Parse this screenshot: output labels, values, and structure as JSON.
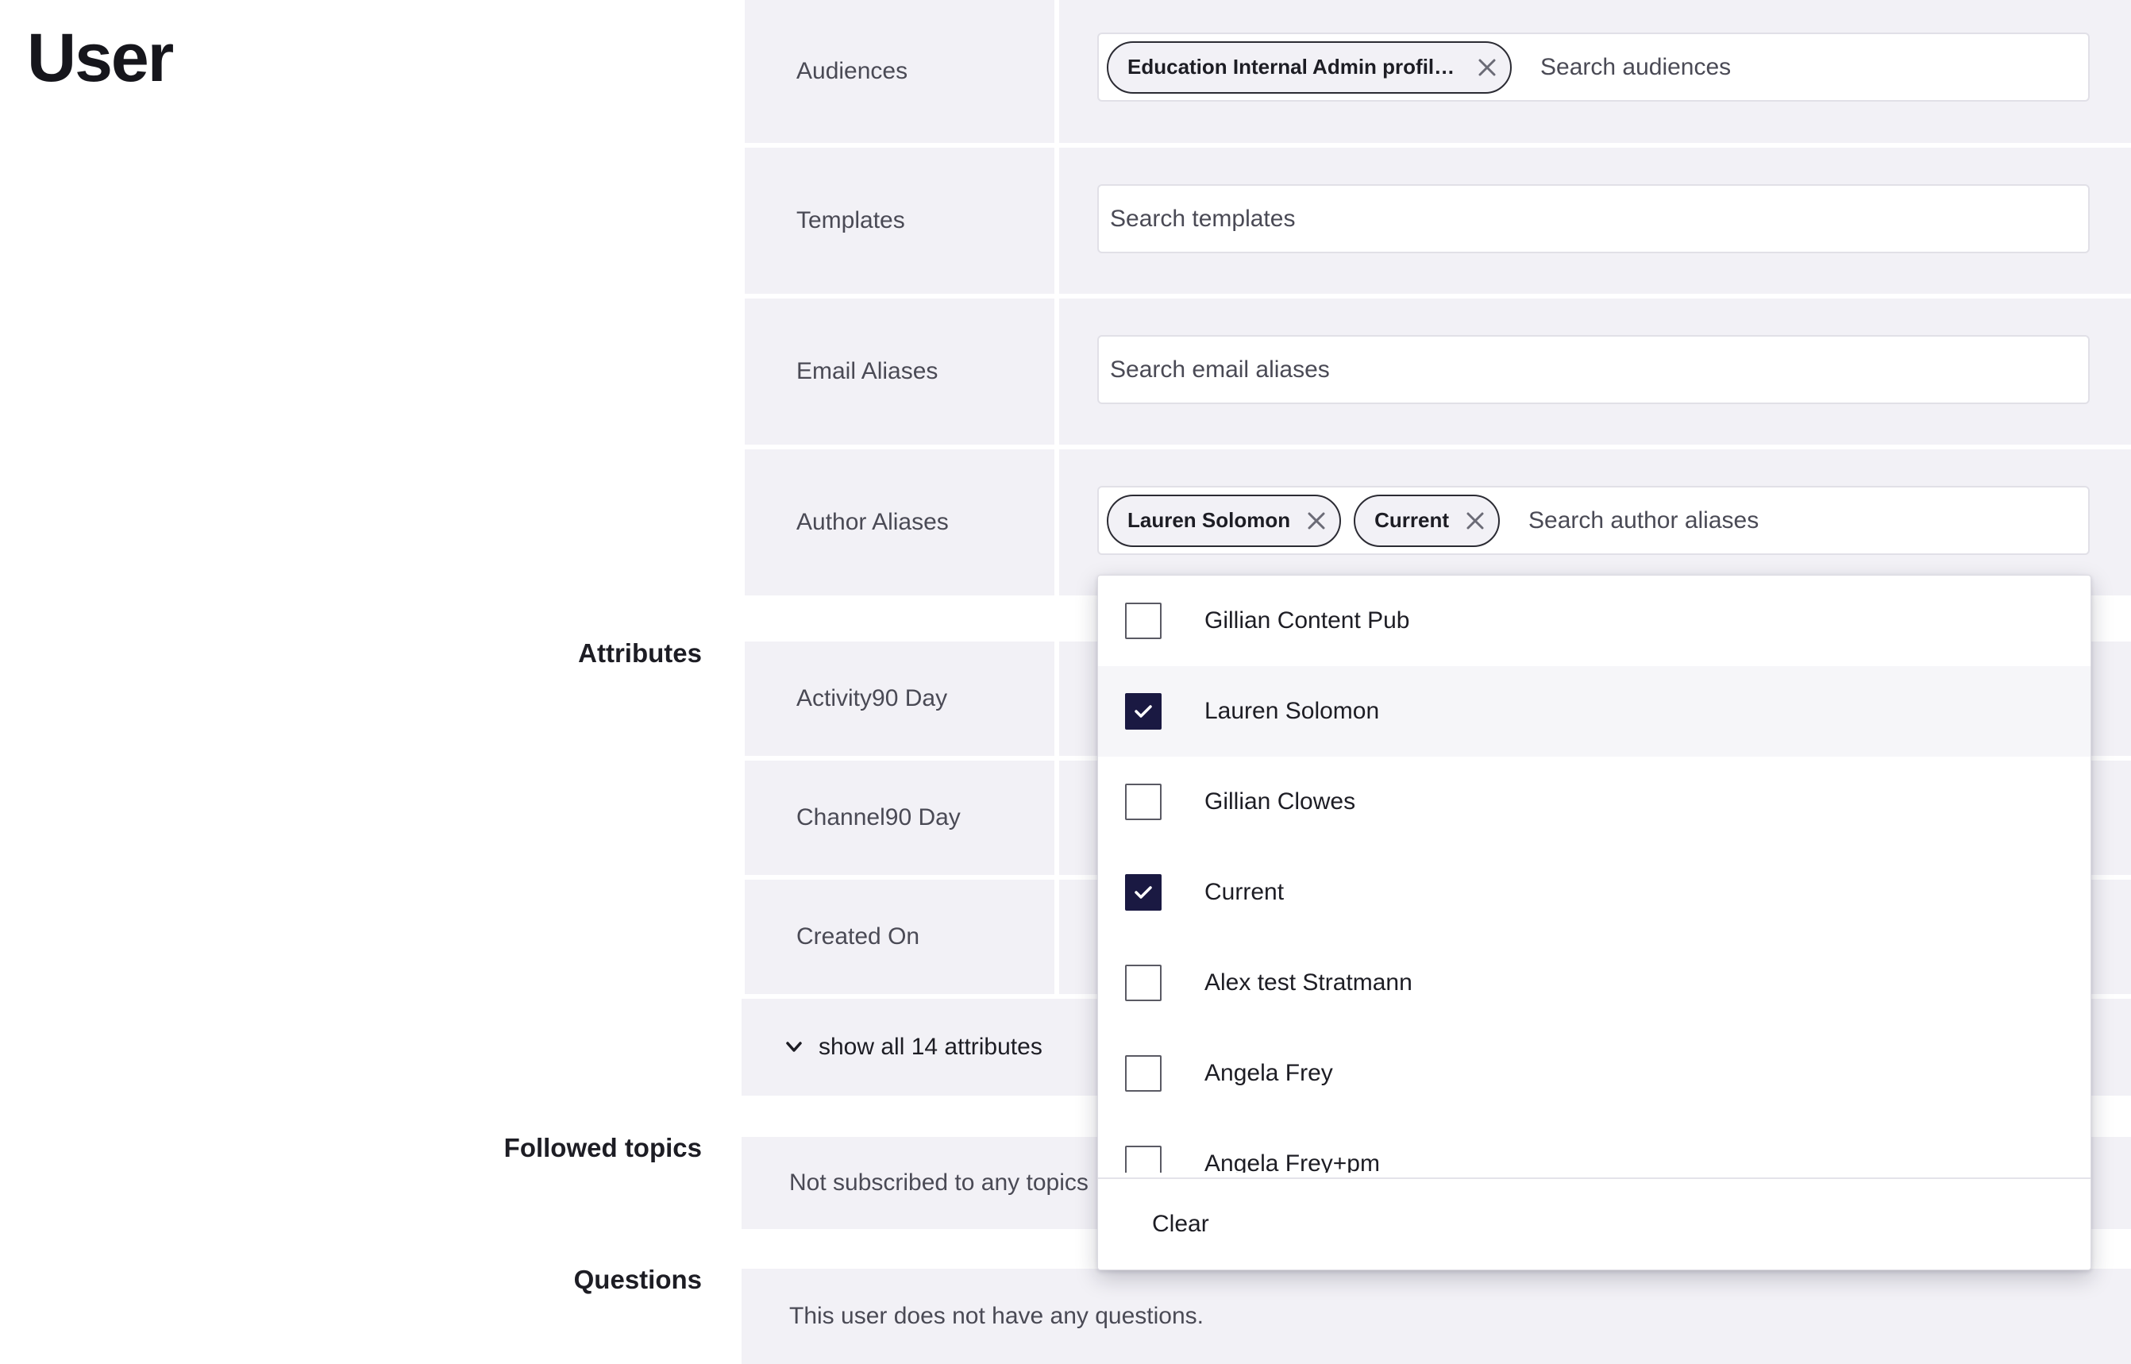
{
  "page": {
    "title": "User"
  },
  "sections": {
    "attributes": "Attributes",
    "followed_topics": "Followed topics",
    "questions": "Questions"
  },
  "fields": {
    "audiences": {
      "label": "Audiences",
      "placeholder": "Search audiences",
      "chips": [
        "Education Internal Admin profile..."
      ]
    },
    "templates": {
      "label": "Templates",
      "placeholder": "Search templates"
    },
    "email_aliases": {
      "label": "Email Aliases",
      "placeholder": "Search email aliases"
    },
    "author_aliases": {
      "label": "Author Aliases",
      "placeholder": "Search author aliases",
      "chips": [
        "Lauren Solomon",
        "Current"
      ]
    }
  },
  "attributes": {
    "rows": [
      "Activity90 Day",
      "Channel90 Day",
      "Created On"
    ],
    "show_all_label": "show all 14 attributes"
  },
  "followed_topics": {
    "empty_text": "Not subscribed to any topics"
  },
  "questions": {
    "empty_text": "This user does not have any questions."
  },
  "dropdown": {
    "options": [
      {
        "label": "Gillian Content Pub",
        "checked": false
      },
      {
        "label": "Lauren Solomon",
        "checked": true
      },
      {
        "label": "Gillian Clowes",
        "checked": false
      },
      {
        "label": "Current",
        "checked": true
      },
      {
        "label": "Alex test Stratmann",
        "checked": false
      },
      {
        "label": "Angela Frey",
        "checked": false
      },
      {
        "label": "Angela Frey+pm",
        "checked": false
      }
    ],
    "clear_label": "Clear"
  },
  "colors": {
    "panel_bg": "#f2f1f6",
    "checkbox_checked": "#1a1942",
    "text": "#1d1d24"
  },
  "icons": {
    "chip_remove": "close-icon",
    "expand": "chevron-down-icon",
    "check": "checkmark-icon"
  }
}
